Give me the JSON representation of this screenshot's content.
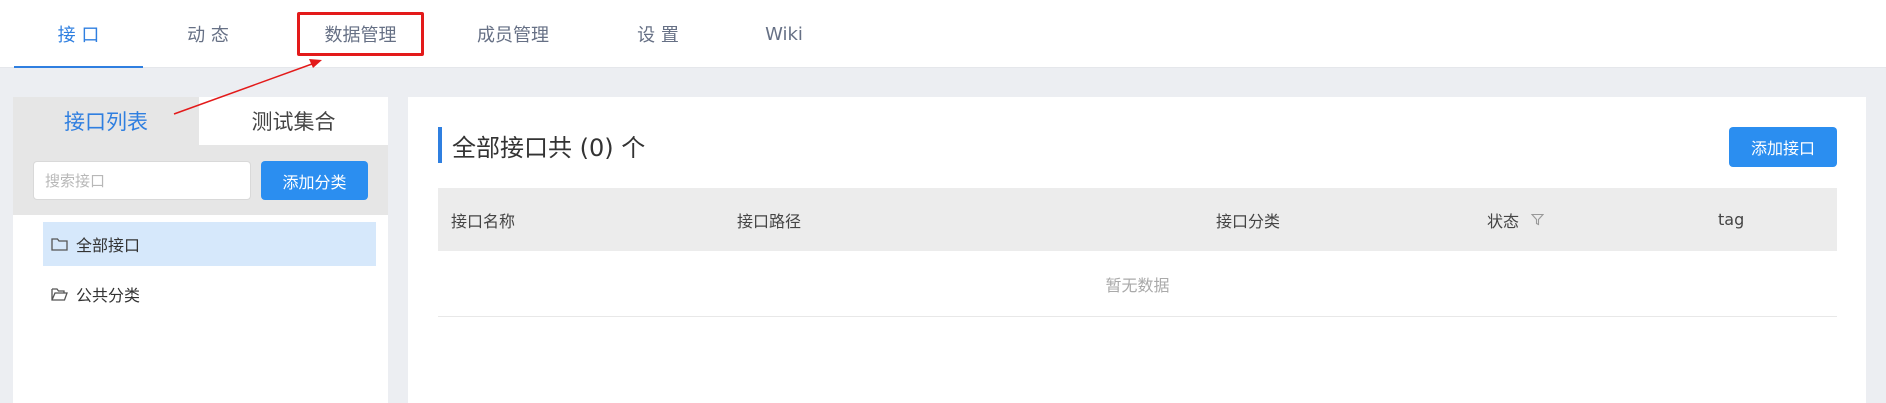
{
  "nav": {
    "tabs": [
      {
        "label": "接 口"
      },
      {
        "label": "动 态"
      },
      {
        "label": "数据管理"
      },
      {
        "label": "成员管理"
      },
      {
        "label": "设 置"
      },
      {
        "label": "Wiki"
      }
    ],
    "active_index": 0,
    "highlighted_index": 2
  },
  "left": {
    "tabs": [
      {
        "label": "接口列表"
      },
      {
        "label": "测试集合"
      }
    ],
    "search": {
      "placeholder": "搜索接口",
      "value": ""
    },
    "add_category_label": "添加分类",
    "tree": [
      {
        "label": "全部接口",
        "icon": "folder-icon",
        "selected": true
      },
      {
        "label": "公共分类",
        "icon": "folder-open-icon",
        "selected": false
      }
    ]
  },
  "main": {
    "title": "全部接口共 (0) 个",
    "add_api_label": "添加接口",
    "columns": [
      "接口名称",
      "接口路径",
      "接口分类",
      "状态",
      "tag"
    ],
    "empty_text": "暂无数据"
  },
  "colors": {
    "accent": "#2f7fe0",
    "primary_button": "#2b8ef0",
    "annotation_red": "#e31a1a"
  }
}
